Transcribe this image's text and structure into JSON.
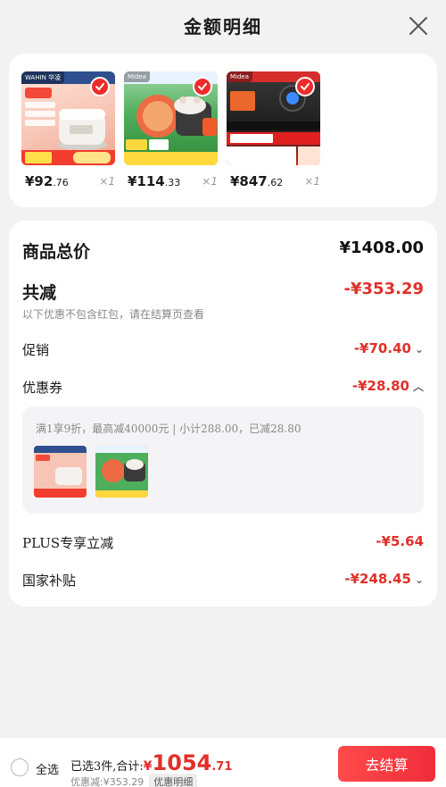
{
  "header": {
    "title": "金额明细"
  },
  "colors": {
    "accent": "#e0302a",
    "check": "#ef2b2b"
  },
  "products": [
    {
      "price": "¥92",
      "cents": ".76",
      "qty": "×1",
      "image": "rice-cooker",
      "badge": "WAHIN 华凌"
    },
    {
      "price": "¥114",
      "cents": ".33",
      "qty": "×1",
      "image": "electric-hotpot",
      "badge": "Midea"
    },
    {
      "price": "¥847",
      "cents": ".62",
      "qty": "×1",
      "image": "gas-stove",
      "badge": "Midea"
    }
  ],
  "summary": {
    "goods_total_label": "商品总价",
    "goods_total_value": "¥1408.00",
    "total_discount_label": "共减",
    "total_discount_value": "-¥353.29",
    "total_discount_note": "以下优惠不包含红包，请在结算页查看",
    "promo_label": "促销",
    "promo_value": "-¥70.40",
    "coupon_label": "优惠券",
    "coupon_value": "-¥28.80",
    "coupon_desc": "满1享9折，最高减40000元 | 小计288.00，已减28.80",
    "plus_label": "PLUS专享立减",
    "plus_value": "-¥5.64",
    "subsidy_label": "国家补贴",
    "subsidy_value": "-¥248.45"
  },
  "bottom": {
    "select_all": "全选",
    "selected_text": "已选3件,合计:",
    "currency": "¥",
    "total_int": "1054",
    "total_cents": ".71",
    "discount_text": "优惠减:¥353.29",
    "detail_label": "优惠明细",
    "checkout_label": "去结算"
  }
}
